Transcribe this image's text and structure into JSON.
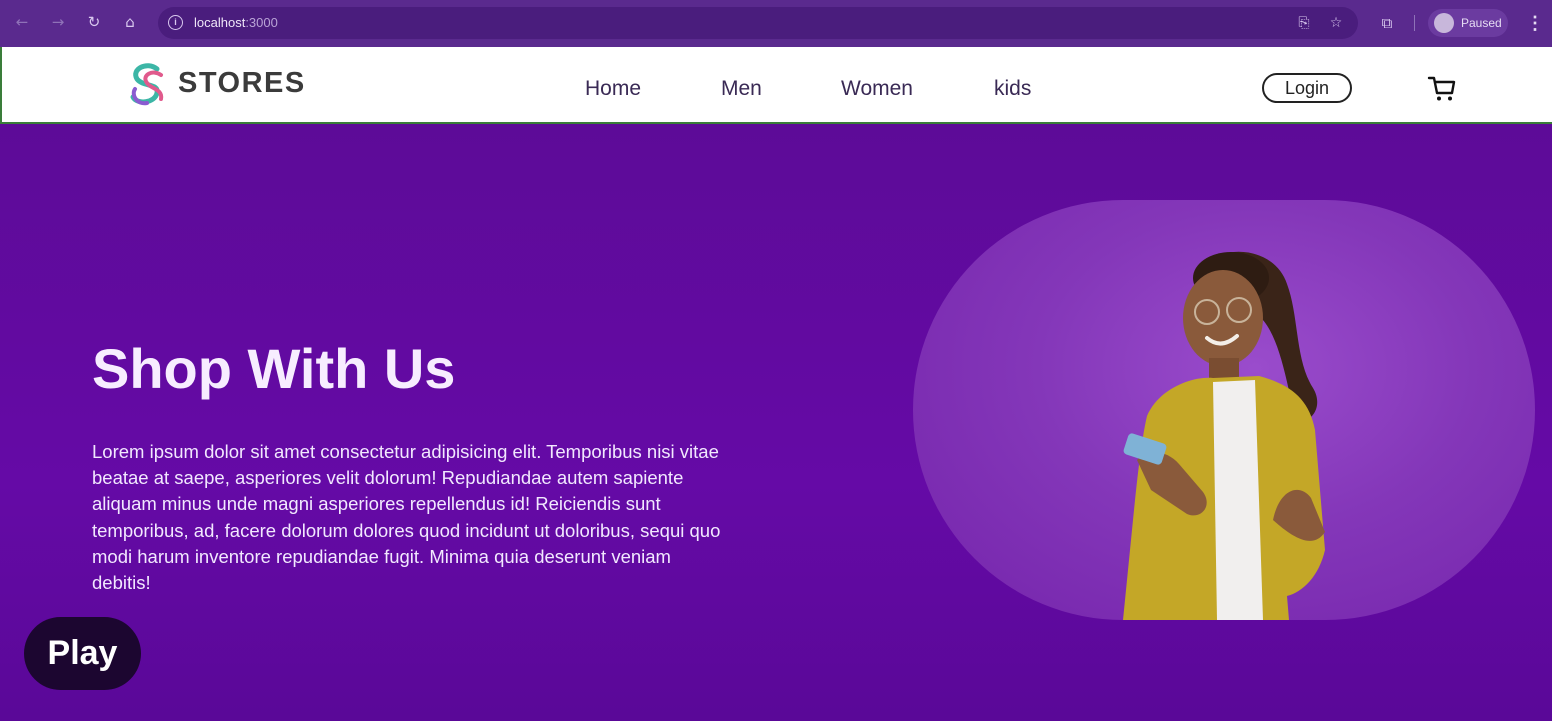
{
  "browser": {
    "url_host": "localhost",
    "url_port": ":3000",
    "profile_label": "Paused",
    "icons": [
      "back-icon",
      "forward-icon",
      "reload-icon",
      "home-icon",
      "info-icon",
      "install-icon",
      "star-icon",
      "extensions-icon",
      "menu-icon"
    ]
  },
  "site": {
    "brand": "STORES",
    "nav": [
      "Home",
      "Men",
      "Women",
      "kids"
    ],
    "login_label": "Login"
  },
  "hero": {
    "title": "Shop With Us",
    "text": "Lorem ipsum dolor sit amet consectetur adipisicing elit. Temporibus nisi vitae beatae at saepe, asperiores velit dolorum! Repudiandae autem sapiente aliquam minus unde magni asperiores repellendus id! Reiciendis sunt temporibus, ad, facere dolorum dolores quod incidunt ut doloribus, sequi quo modi harum inventore repudiandae fugit. Minima quia deserunt veniam debitis!"
  },
  "overlay": {
    "play_label": "Play"
  },
  "colors": {
    "chrome": "#5a2a8e",
    "hero_bg": "#5f0b9a",
    "blob": "#8437b9",
    "header_bg": "#ffffff",
    "play_bg": "#1c0630"
  }
}
